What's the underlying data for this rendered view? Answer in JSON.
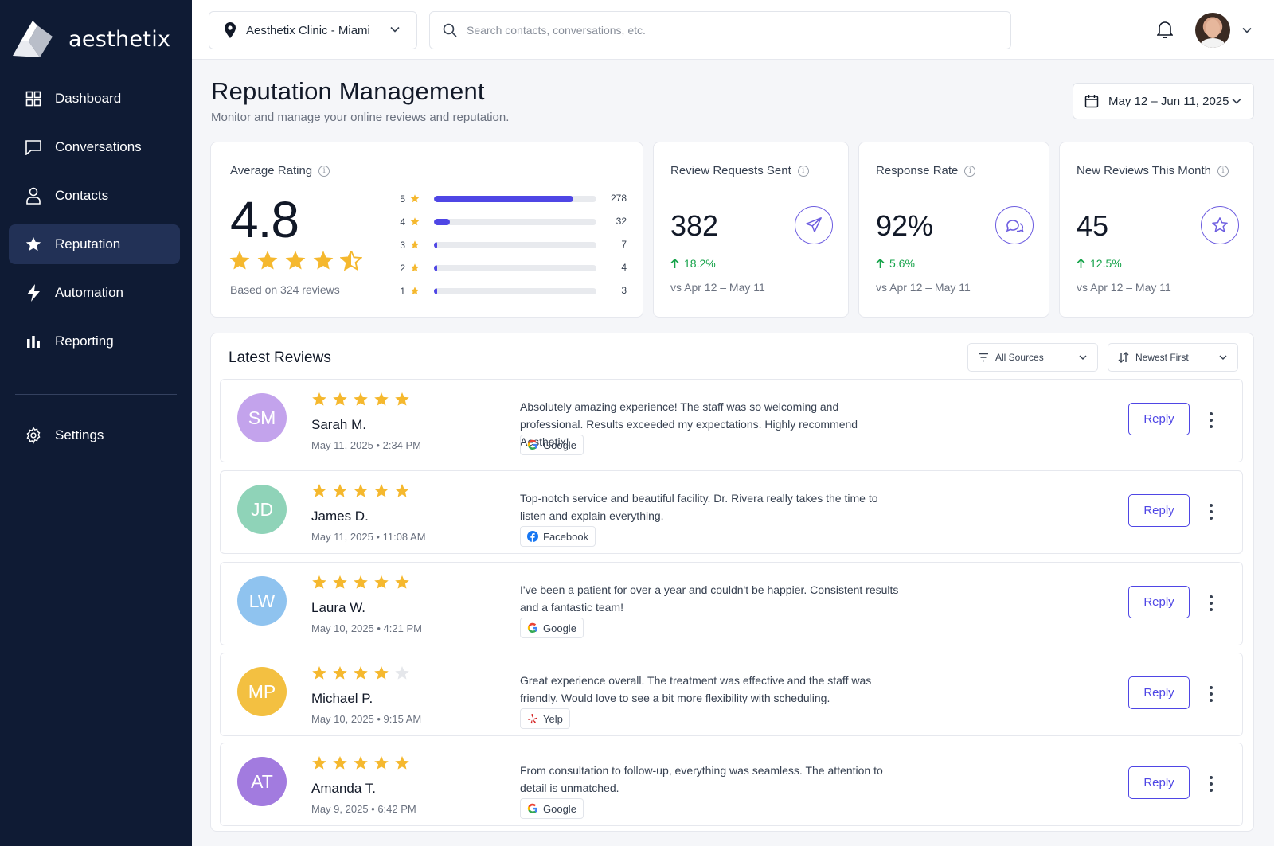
{
  "app": {
    "brand": "aesthetix"
  },
  "sidebar": {
    "items": [
      {
        "label": "Dashboard",
        "icon": "grid-icon"
      },
      {
        "label": "Conversations",
        "icon": "chat-icon"
      },
      {
        "label": "Contacts",
        "icon": "user-icon"
      },
      {
        "label": "Reputation",
        "icon": "star-icon",
        "active": true
      },
      {
        "label": "Automation",
        "icon": "bolt-icon"
      },
      {
        "label": "Reporting",
        "icon": "bar-chart-icon"
      }
    ],
    "settings": {
      "label": "Settings",
      "icon": "gear-icon"
    }
  },
  "topbar": {
    "clinic": "Aesthetix Clinic - Miami",
    "search_placeholder": "Search contacts, conversations, etc."
  },
  "header": {
    "title": "Reputation Management",
    "subtitle": "Monitor and manage your online reviews and reputation.",
    "date_range": "May 12 – Jun 11, 2025"
  },
  "rating": {
    "title": "Average Rating",
    "value": "4.8",
    "stars": 4.5,
    "based_on": "Based on 324 reviews",
    "distribution": [
      {
        "stars": "5",
        "count": 278
      },
      {
        "stars": "4",
        "count": 32
      },
      {
        "stars": "3",
        "count": 7
      },
      {
        "stars": "2",
        "count": 4
      },
      {
        "stars": "1",
        "count": 3
      }
    ],
    "distribution_labels": {
      "c5": "278",
      "c4": "32",
      "c3": "7",
      "c2": "4",
      "c1": "3"
    }
  },
  "stats": [
    {
      "title": "Review Requests Sent",
      "value": "382",
      "change": "18.2%",
      "vs": "vs Apr 12 – May 11",
      "icon": "send-icon"
    },
    {
      "title": "Response Rate",
      "value": "92%",
      "change": "5.6%",
      "vs": "vs Apr 12 – May 11",
      "icon": "chat-bubbles-icon"
    },
    {
      "title": "New Reviews This Month",
      "value": "45",
      "change": "12.5%",
      "vs": "vs Apr 12 – May 11",
      "icon": "star-outline-icon"
    }
  ],
  "reviews": {
    "title": "Latest Reviews",
    "filter_source": "All Sources",
    "sort": "Newest First",
    "reply_label": "Reply",
    "items": [
      {
        "initials": "SM",
        "name": "Sarah M.",
        "date": "May 11, 2025  •  2:34 PM",
        "stars": 5,
        "text": "Absolutely amazing experience! The staff was so welcoming and professional. Results exceeded my expectations. Highly recommend Aesthetix!",
        "source": "Google",
        "color": "#c3a3ec"
      },
      {
        "initials": "JD",
        "name": "James D.",
        "date": "May 11, 2025  •  11:08 AM",
        "stars": 5,
        "text": "Top-notch service and beautiful facility. Dr. Rivera really takes the time to listen and explain everything.",
        "source": "Facebook",
        "color": "#8fd3b8"
      },
      {
        "initials": "LW",
        "name": "Laura W.",
        "date": "May 10, 2025  •  4:21 PM",
        "stars": 5,
        "text": "I've been a patient for over a year and couldn't be happier. Consistent results and a fantastic team!",
        "source": "Google",
        "color": "#8fc3ef"
      },
      {
        "initials": "MP",
        "name": "Michael P.",
        "date": "May 10, 2025  •  9:15 AM",
        "stars": 4,
        "text": "Great experience overall. The treatment was effective and the staff was friendly. Would love to see a bit more flexibility with scheduling.",
        "source": "Yelp",
        "color": "#f3c041"
      },
      {
        "initials": "AT",
        "name": "Amanda T.",
        "date": "May 9, 2025  •  6:42 PM",
        "stars": 5,
        "text": "From consultation to follow-up, everything was seamless. The attention to detail is unmatched.",
        "source": "Google",
        "color": "#a27bdf"
      }
    ]
  },
  "colors": {
    "accent": "#4f46e5",
    "star": "#f5b82e",
    "sidebar": "#0f1b34",
    "positive": "#16a34a"
  }
}
